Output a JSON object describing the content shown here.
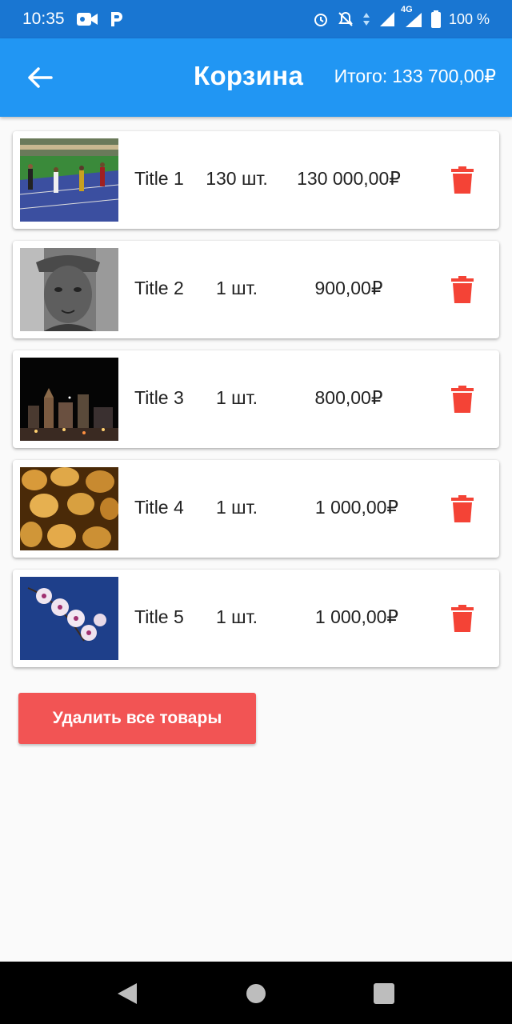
{
  "status_bar": {
    "time": "10:35",
    "battery": "100 %",
    "network": "4G",
    "left_icons": [
      "video-camera-icon",
      "parking-app-icon"
    ],
    "right_icons": [
      "alarm-icon",
      "notifications-off-icon",
      "data-arrows-icon",
      "signal-icon",
      "signal-4g-icon",
      "battery-icon"
    ]
  },
  "app_bar": {
    "back_icon": "arrow-back-icon",
    "title": "Корзина",
    "total_label": "Итого:",
    "total_value": "133 700,00₽",
    "color": "#2196f3"
  },
  "cart": {
    "items": [
      {
        "title": "Title 1",
        "quantity": "130 шт.",
        "price": "130 000,00₽",
        "image": "track-runners-photo"
      },
      {
        "title": "Title 2",
        "quantity": "1 шт.",
        "price": "900,00₽",
        "image": "old-man-portrait-photo"
      },
      {
        "title": "Title 3",
        "quantity": "1 шт.",
        "price": "800,00₽",
        "image": "night-city-photo"
      },
      {
        "title": "Title 4",
        "quantity": "1 шт.",
        "price": "1 000,00₽",
        "image": "nuts-photo"
      },
      {
        "title": "Title 5",
        "quantity": "1 шт.",
        "price": "1 000,00₽",
        "image": "orchid-flowers-photo"
      }
    ],
    "delete_icon": "trash-icon",
    "delete_color": "#f44336"
  },
  "actions": {
    "delete_all_label": "Удалить все товары",
    "delete_all_color": "#f25454"
  },
  "nav_bar": {
    "icons": [
      "nav-back-icon",
      "nav-home-icon",
      "nav-recents-icon"
    ]
  }
}
